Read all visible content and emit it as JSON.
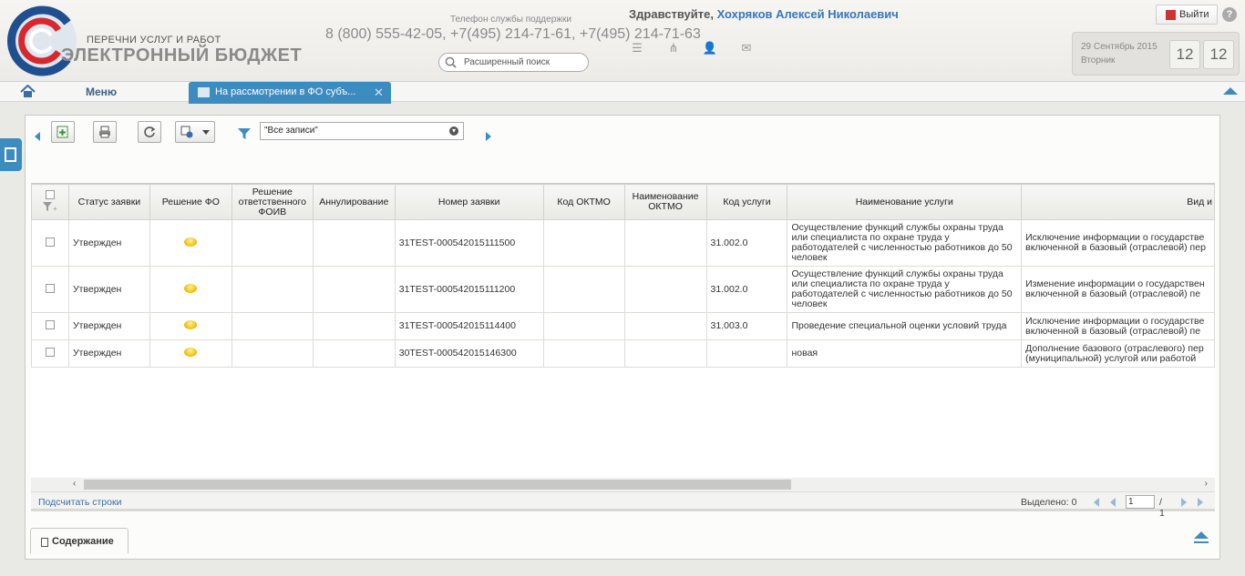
{
  "header": {
    "logo_sub": "ПЕРЕЧНИ УСЛУГ И РАБОТ",
    "logo_title": "ЭЛЕКТРОННЫЙ БЮДЖЕТ",
    "support_label": "Телефон службы поддержки",
    "support_phones": "8 (800) 555-42-05, +7(495) 214-71-61, +7(495) 214-71-63",
    "search_placeholder": "Расширенный поиск",
    "greeting": "Здравствуйте,",
    "user_name": "Хохряков Алексей Николаевич",
    "logout_label": "Выйти",
    "help_label": "?",
    "date": "29 Сентябрь 2015",
    "weekday": "Вторник",
    "clock_left": "12",
    "clock_right": "12"
  },
  "nav": {
    "menu_label": "Меню",
    "active_tab_label": "На рассмотрении в ФО субъ...",
    "close_glyph": "✕"
  },
  "toolbar": {
    "filter_value": "\"Все записи\""
  },
  "table": {
    "columns": [
      "",
      "Статус заявки",
      "Решение ФО",
      "Решение ответственного ФОИВ",
      "Аннулирование",
      "Номер заявки",
      "Код ОКТМО",
      "Наименование ОКТМО",
      "Код услуги",
      "Наименование услуги",
      "Вид и"
    ],
    "rows": [
      {
        "status": "Утвержден",
        "fo_decision": "",
        "foiv_decision": "",
        "annulment": "",
        "number": "31TEST-000542015111500",
        "oktmo_code": "",
        "oktmo_name": "",
        "service_code": "31.002.0",
        "service_name": "Осуществление функций службы охраны труда или специалиста по охране труда у работодателей с численностью работников до 50 человек",
        "kind": "Исключение информации о государстве включенной в базовый (отраслевой) пер"
      },
      {
        "status": "Утвержден",
        "fo_decision": "",
        "foiv_decision": "",
        "annulment": "",
        "number": "31TEST-000542015111200",
        "oktmo_code": "",
        "oktmo_name": "",
        "service_code": "31.002.0",
        "service_name": "Осуществление функций службы охраны труда или специалиста по охране труда у работодателей с численностью работников до 50 человек",
        "kind": "Изменение информации о государствен включенной в базовый (отраслевой) пе"
      },
      {
        "status": "Утвержден",
        "fo_decision": "",
        "foiv_decision": "",
        "annulment": "",
        "number": "31TEST-000542015114400",
        "oktmo_code": "",
        "oktmo_name": "",
        "service_code": "31.003.0",
        "service_name": "Проведение специальной оценки условий труда",
        "kind": "Исключение информации о государстве включенной в базовый (отраслевой) пе"
      },
      {
        "status": "Утвержден",
        "fo_decision": "",
        "foiv_decision": "",
        "annulment": "",
        "number": "30TEST-000542015146300",
        "oktmo_code": "",
        "oktmo_name": "",
        "service_code": "",
        "service_name": "новая",
        "kind": "Дополнение базового (отраслевого) пер (муниципальной) услугой или работой"
      }
    ]
  },
  "footer": {
    "count_rows": "Подсчитать строки",
    "selected": "Выделено: 0",
    "page_value": "1",
    "page_total": "/ 1"
  },
  "bottom_tab": {
    "label": "Содержание"
  },
  "colors": {
    "accent": "#3d8cbf",
    "link": "#3a77b7"
  }
}
